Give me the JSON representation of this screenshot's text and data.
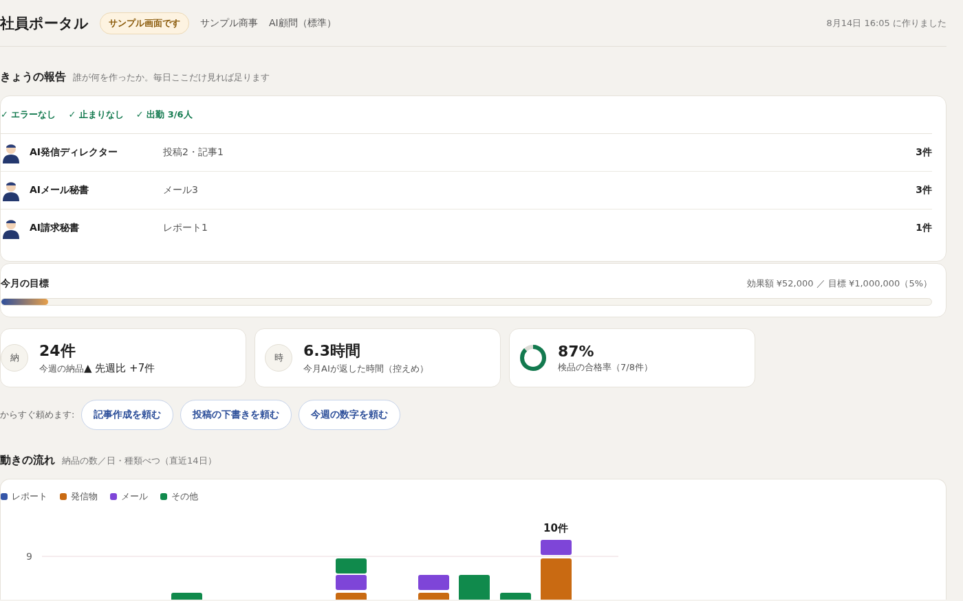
{
  "header": {
    "title": "社員ポータル",
    "badge": "サンプル画面です",
    "company": "サンプル商事",
    "plan": "AI顧問（標準）",
    "created": "8月14日 16:05 に作りました"
  },
  "report": {
    "title": "きょうの報告",
    "subtitle": "誰が何を作ったか。毎日ここだけ見れば足ります",
    "checks": [
      "✓ エラーなし",
      "✓ 止まりなし",
      "✓ 出勤 3/6人"
    ],
    "agents": [
      {
        "name": "AI発信ディレクター",
        "work": "投稿2・記事1",
        "count": "3件"
      },
      {
        "name": "AIメール秘書",
        "work": "メール3",
        "count": "3件"
      },
      {
        "name": "AI請求秘書",
        "work": "レポート1",
        "count": "1件"
      }
    ]
  },
  "goal": {
    "title": "今月の目標",
    "summary": "効果額 ¥52,000 ／ 目標 ¥1,000,000（5%）",
    "level": 0.05
  },
  "stats": [
    {
      "kind": "glyph",
      "glyph": "納",
      "value": "24件",
      "label": "今週の納品",
      "trend": "▲ 先週比 +7件"
    },
    {
      "kind": "glyph",
      "glyph": "時",
      "value": "6.3時間",
      "label": "今月AIが返した時間（控えめ）"
    },
    {
      "kind": "donut",
      "level": 0.875,
      "value": "87%",
      "label": "検品の合格率（7/8件）"
    }
  ],
  "quick": {
    "label": "からすぐ頼めます:",
    "buttons": [
      "記事作成を頼む",
      "投稿の下書きを頼む",
      "今週の数字を頼む"
    ]
  },
  "flow": {
    "title": "動きの流れ",
    "subtitle": "納品の数／日・種類べつ（直近14日）",
    "legend": [
      {
        "label": "レポート",
        "color": "#3556a8"
      },
      {
        "label": "発信物",
        "color": "#c96a12"
      },
      {
        "label": "メール",
        "color": "#7e45d8"
      },
      {
        "label": "その他",
        "color": "#108a4c"
      }
    ],
    "tick_label": "9",
    "data_label": "10件"
  }
}
